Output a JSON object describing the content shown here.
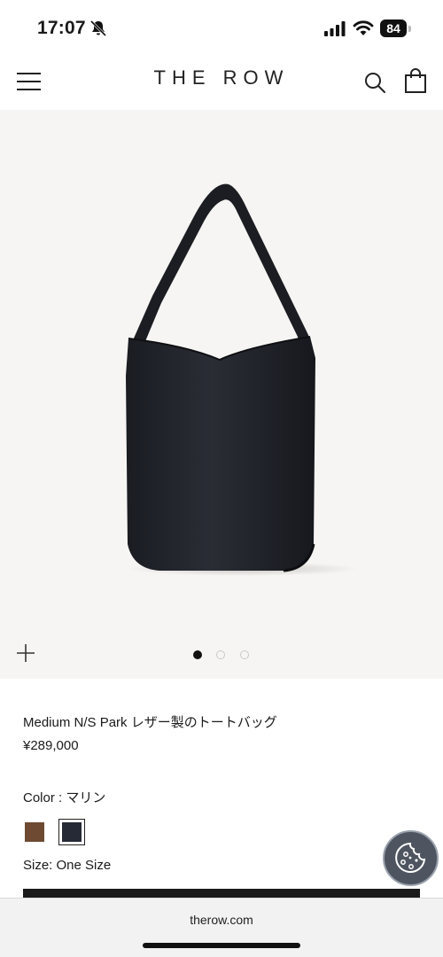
{
  "status_bar": {
    "time": "17:07",
    "battery_level": "84",
    "icons": [
      "bell-slash-icon",
      "cellular-signal-icon",
      "wifi-icon",
      "battery-icon"
    ]
  },
  "header": {
    "logo": "THE ROW",
    "icons": [
      "hamburger-menu-icon",
      "search-icon",
      "shopping-bag-icon"
    ]
  },
  "gallery": {
    "image_subject": "black leather tote bag",
    "current_index": 1,
    "total_images": 3,
    "icons": [
      "plus-zoom-icon"
    ]
  },
  "product": {
    "title": "Medium N/S Park レザー製のトートバッグ",
    "price": "¥289,000",
    "color_label": "Color : マリン",
    "swatches": [
      {
        "name": "brown",
        "color": "#6e4a32",
        "selected": false
      },
      {
        "name": "marine",
        "color": "#262a36",
        "selected": true
      }
    ],
    "size_label": "Size: One Size"
  },
  "cookie": {
    "icon": "cookie-icon",
    "color": "#4e5560"
  },
  "browser": {
    "url": "therow.com"
  }
}
